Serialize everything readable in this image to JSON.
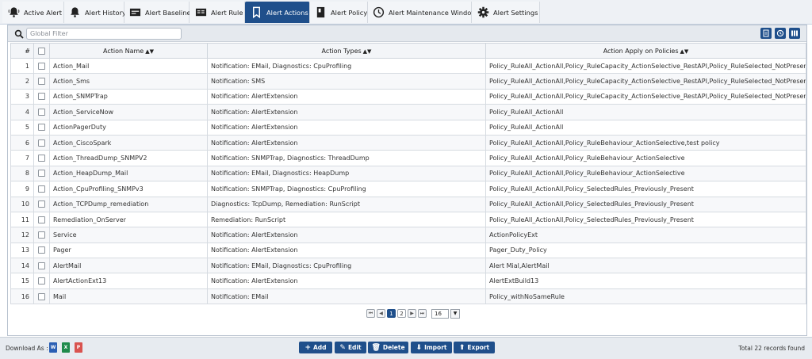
{
  "tabs": [
    {
      "label": "Active Alert",
      "icon": "bell-alert-icon"
    },
    {
      "label": "Alert History",
      "icon": "bell-icon"
    },
    {
      "label": "Alert Baseline",
      "icon": "baseline-icon"
    },
    {
      "label": "Alert Rule",
      "icon": "rule-icon"
    },
    {
      "label": "Alert Actions",
      "icon": "bookmark-icon",
      "active": true
    },
    {
      "label": "Alert Policy",
      "icon": "policy-icon"
    },
    {
      "label": "Alert Maintenance Window",
      "icon": "clock-icon"
    },
    {
      "label": "Alert Settings",
      "icon": "gear-icon"
    }
  ],
  "toolbar": {
    "filter_placeholder": "Global Filter",
    "buttons": [
      "export-icon",
      "history-icon",
      "columns-icon"
    ]
  },
  "table": {
    "columns": {
      "num": "#",
      "name": "Action Name",
      "types": "Action Types",
      "policies": "Action Apply on Policies"
    },
    "rows": [
      {
        "n": "1",
        "name": "Action_Mail",
        "types": "Notification: EMail, Diagnostics: CpuProfiling",
        "policies": "Policy_RuleAll_ActionAll,Policy_RuleCapacity_ActionSelective_RestAPI,Policy_RuleSelected_NotPresentPrevious"
      },
      {
        "n": "2",
        "name": "Action_Sms",
        "types": "Notification: SMS",
        "policies": "Policy_RuleAll_ActionAll,Policy_RuleCapacity_ActionSelective_RestAPI,Policy_RuleSelected_NotPresentPrevious"
      },
      {
        "n": "3",
        "name": "Action_SNMPTrap",
        "types": "Notification: AlertExtension",
        "policies": "Policy_RuleAll_ActionAll,Policy_RuleCapacity_ActionSelective_RestAPI,Policy_RuleSelected_NotPresentPrevious"
      },
      {
        "n": "4",
        "name": "Action_ServiceNow",
        "types": "Notification: AlertExtension",
        "policies": "Policy_RuleAll_ActionAll"
      },
      {
        "n": "5",
        "name": "ActionPagerDuty",
        "types": "Notification: AlertExtension",
        "policies": "Policy_RuleAll_ActionAll"
      },
      {
        "n": "6",
        "name": "Action_CiscoSpark",
        "types": "Notification: AlertExtension",
        "policies": "Policy_RuleAll_ActionAll,Policy_RuleBehaviour_ActionSelective,test policy"
      },
      {
        "n": "7",
        "name": "Action_ThreadDump_SNMPV2",
        "types": "Notification: SNMPTrap, Diagnostics: ThreadDump",
        "policies": "Policy_RuleAll_ActionAll,Policy_RuleBehaviour_ActionSelective"
      },
      {
        "n": "8",
        "name": "Action_HeapDump_Mail",
        "types": "Notification: EMail, Diagnostics: HeapDump",
        "policies": "Policy_RuleAll_ActionAll,Policy_RuleBehaviour_ActionSelective"
      },
      {
        "n": "9",
        "name": "Action_CpuProfiling_SNMPv3",
        "types": "Notification: SNMPTrap, Diagnostics: CpuProfiling",
        "policies": "Policy_RuleAll_ActionAll,Policy_SelectedRules_Previously_Present"
      },
      {
        "n": "10",
        "name": "Action_TCPDump_remediation",
        "types": "Diagnostics: TcpDump, Remediation: RunScript",
        "policies": "Policy_RuleAll_ActionAll,Policy_SelectedRules_Previously_Present"
      },
      {
        "n": "11",
        "name": "Remediation_OnServer",
        "types": "Remediation: RunScript",
        "policies": "Policy_RuleAll_ActionAll,Policy_SelectedRules_Previously_Present"
      },
      {
        "n": "12",
        "name": "Service",
        "types": "Notification: AlertExtension",
        "policies": "ActionPolicyExt"
      },
      {
        "n": "13",
        "name": "Pager",
        "types": "Notification: AlertExtension",
        "policies": "Pager_Duty_Policy"
      },
      {
        "n": "14",
        "name": "AlertMail",
        "types": "Notification: EMail, Diagnostics: CpuProfiling",
        "policies": "Alert Mial,AlertMail"
      },
      {
        "n": "15",
        "name": "AlertActionExt13",
        "types": "Notification: AlertExtension",
        "policies": "AlertExtBuild13"
      },
      {
        "n": "16",
        "name": "Mail",
        "types": "Notification: EMail",
        "policies": "Policy_withNoSameRule"
      }
    ]
  },
  "pager": {
    "pages": [
      "1",
      "2"
    ],
    "current_page": "1",
    "page_size": "16"
  },
  "footer": {
    "download_label": "Download As :",
    "download_formats": [
      "W",
      "X",
      "P"
    ],
    "buttons": {
      "add": "Add",
      "edit": "Edit",
      "delete": "Delete",
      "import": "Import",
      "export": "Export"
    },
    "total": "Total 22 records found"
  },
  "colors": {
    "accent": "#1f4f8b",
    "word": "#2b5fb4",
    "excel": "#1f8b4c",
    "pdf": "#d9534f"
  }
}
